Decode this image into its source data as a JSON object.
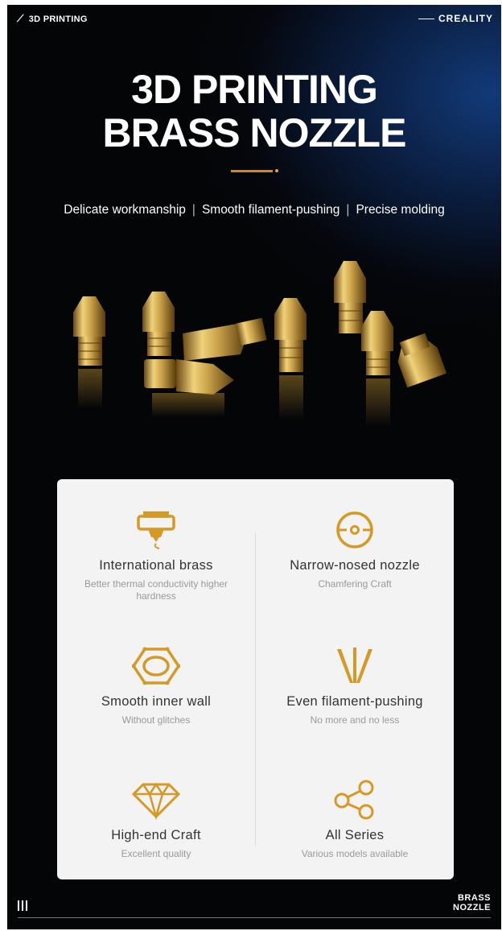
{
  "header": {
    "section_label": "3D PRINTING",
    "brand": "CREALITY"
  },
  "hero": {
    "title_line1": "3D PRINTING",
    "title_line2": "BRASS NOZZLE",
    "features": [
      "Delicate workmanship",
      "Smooth filament-pushing",
      "Precise molding"
    ]
  },
  "accent_color": "#c58a2a",
  "card": {
    "items": [
      {
        "icon": "nozzle-icon",
        "title": "International brass",
        "subtitle": "Better thermal conductivity higher hardness"
      },
      {
        "icon": "target-circle-icon",
        "title": "Narrow-nosed nozzle",
        "subtitle": "Chamfering Craft"
      },
      {
        "icon": "hexagon-nut-icon",
        "title": "Smooth inner wall",
        "subtitle": "Without glitches"
      },
      {
        "icon": "filament-lines-icon",
        "title": "Even filament-pushing",
        "subtitle": "No more and no less"
      },
      {
        "icon": "diamond-icon",
        "title": "High-end Craft",
        "subtitle": "Excellent quality"
      },
      {
        "icon": "share-nodes-icon",
        "title": "All Series",
        "subtitle": "Various models available"
      }
    ]
  },
  "footer": {
    "label_line1": "BRASS",
    "label_line2": "NOZZLE"
  }
}
